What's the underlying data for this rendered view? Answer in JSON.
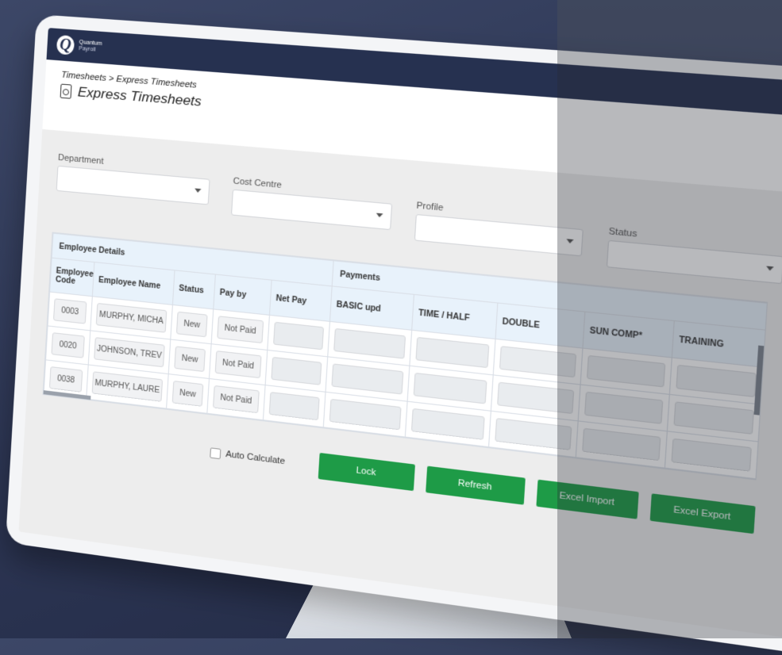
{
  "brand": {
    "name": "Quantum",
    "subtitle": "Payroll",
    "logo_letter": "Q"
  },
  "header": {
    "breadcrumb": "Timesheets > Express Timesheets",
    "title": "Express Timesheets"
  },
  "filters": [
    {
      "label": "Department",
      "value": ""
    },
    {
      "label": "Cost Centre",
      "value": ""
    },
    {
      "label": "Profile",
      "value": ""
    },
    {
      "label": "Status",
      "value": ""
    }
  ],
  "table": {
    "groups": {
      "employee": "Employee Details",
      "payments": "Payments"
    },
    "columns": [
      "Employee Code",
      "Employee Name",
      "Status",
      "Pay by",
      "Net Pay",
      "BASIC upd",
      "TIME / HALF",
      "DOUBLE",
      "SUN COMP*",
      "TRAINING"
    ],
    "rows": [
      {
        "code": "0003",
        "name": "MURPHY, MICHA",
        "status": "New",
        "pay_by": "Not Paid"
      },
      {
        "code": "0020",
        "name": "JOHNSON, TREV",
        "status": "New",
        "pay_by": "Not Paid"
      },
      {
        "code": "0038",
        "name": "MURPHY, LAURE",
        "status": "New",
        "pay_by": "Not Paid"
      }
    ]
  },
  "actions": {
    "auto_calculate": "Auto Calculate",
    "lock": "Lock",
    "refresh": "Refresh",
    "excel_import": "Excel Import",
    "excel_export": "Excel Export"
  },
  "colors": {
    "accent": "#1e9b47",
    "topbar": "#263150",
    "header_bg": "#e8f2fb"
  },
  "icons": [
    "logo-mark",
    "menu-icon",
    "timesheet-icon",
    "dropdown-caret-icon",
    "checkbox"
  ]
}
